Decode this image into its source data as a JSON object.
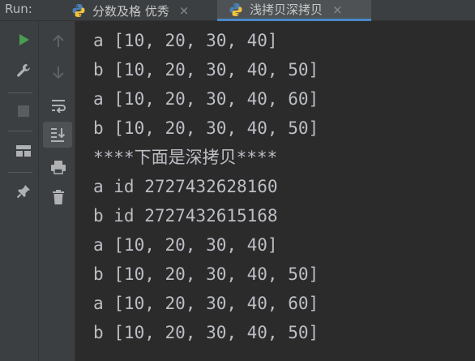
{
  "run_panel": {
    "label": "Run:",
    "tabs": [
      {
        "label": "分数及格 优秀",
        "active": false
      },
      {
        "label": "浅拷贝深拷贝",
        "active": true
      }
    ],
    "close_glyph": "×"
  },
  "toolbar": {
    "left": [
      "rerun-icon",
      "wrench-icon",
      "stop-icon",
      "layout-icon",
      "pin-icon"
    ],
    "right": [
      "arrow-up-icon",
      "arrow-down-icon",
      "soft-wrap-icon",
      "scroll-to-end-icon",
      "print-icon",
      "trash-icon"
    ]
  },
  "console": {
    "lines": [
      "a [10, 20, 30, 40]",
      "b [10, 20, 30, 40, 50]",
      "a [10, 20, 30, 40, 60]",
      "b [10, 20, 30, 40, 50]",
      "****下面是深拷贝****",
      "a id 2727432628160",
      "b id 2727432615168",
      "a [10, 20, 30, 40]",
      "b [10, 20, 30, 40, 50]",
      "a [10, 20, 30, 40, 60]",
      "b [10, 20, 30, 40, 50]"
    ]
  },
  "colors": {
    "run_green": "#499c54",
    "accent_blue": "#4a88c7",
    "console_text": "#bcbec4"
  }
}
